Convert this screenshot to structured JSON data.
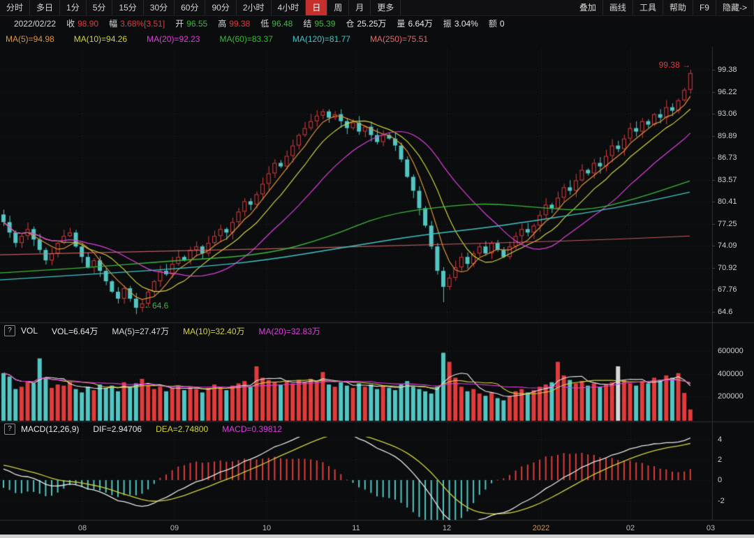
{
  "toolbar": {
    "left_tabs": [
      "分时",
      "多日",
      "1分",
      "5分",
      "15分",
      "30分",
      "60分",
      "90分",
      "2小时",
      "4小时",
      "日",
      "周",
      "月",
      "更多"
    ],
    "active_index": 10,
    "right_tabs": [
      "叠加",
      "画线",
      "工具",
      "帮助",
      "F9",
      "隐藏->"
    ]
  },
  "info_bar": {
    "date": "2022/02/22",
    "fields": [
      {
        "label": "收",
        "value": "98.90",
        "color": "#e23b3b"
      },
      {
        "label": "幅",
        "value": "3.68%[3.51]",
        "color": "#e23b3b"
      },
      {
        "label": "开",
        "value": "96.55",
        "color": "#3db93d"
      },
      {
        "label": "高",
        "value": "99.38",
        "color": "#e23b3b"
      },
      {
        "label": "低",
        "value": "96.48",
        "color": "#3db93d"
      },
      {
        "label": "结",
        "value": "95.39",
        "color": "#3db93d"
      },
      {
        "label": "仓",
        "value": "25.25万",
        "color": "#e8e8e8"
      },
      {
        "label": "量",
        "value": "6.64万",
        "color": "#e8e8e8"
      },
      {
        "label": "振",
        "value": "3.04%",
        "color": "#e8e8e8"
      },
      {
        "label": "额",
        "value": "0",
        "color": "#e8e8e8"
      }
    ]
  },
  "price_ma_legend": [
    {
      "text": "MA(5)=94.98",
      "color": "#e0953c"
    },
    {
      "text": "MA(10)=94.26",
      "color": "#d3d33f"
    },
    {
      "text": "MA(20)=92.23",
      "color": "#df3fdf"
    },
    {
      "text": "MA(60)=83.37",
      "color": "#3bb93b"
    },
    {
      "text": "MA(120)=81.77",
      "color": "#3fc6c6"
    },
    {
      "text": "MA(250)=75.51",
      "color": "#e06c6c"
    }
  ],
  "vol_header": {
    "help_icon": "?",
    "title": "VOL",
    "fields": [
      {
        "text": "VOL=6.64万",
        "color": "#e8e8e8"
      },
      {
        "text": "MA(5)=27.47万",
        "color": "#d9d9d9"
      },
      {
        "text": "MA(10)=32.40万",
        "color": "#d3d33f"
      },
      {
        "text": "MA(20)=32.83万",
        "color": "#df3fdf"
      }
    ]
  },
  "macd_header": {
    "help_icon": "?",
    "title": "MACD(12,26,9)",
    "fields": [
      {
        "text": "DIF=2.94706",
        "color": "#e8e8e8"
      },
      {
        "text": "DEA=2.74800",
        "color": "#d3d33f"
      },
      {
        "text": "MACD=0.39812",
        "color": "#df3fdf"
      }
    ]
  },
  "chart_data": {
    "type": "candlestick+volume+macd",
    "price_axis_labels": [
      "99.38",
      "96.22",
      "93.06",
      "89.89",
      "86.73",
      "83.57",
      "80.41",
      "77.25",
      "74.09",
      "70.92",
      "67.76",
      "64.6"
    ],
    "volume_axis_labels": [
      "600000",
      "400000",
      "200000"
    ],
    "macd_axis_labels": [
      "4",
      "2",
      "0",
      "-2"
    ],
    "x_axis": {
      "labels": [
        "08",
        "09",
        "10",
        "11",
        "12",
        "2022",
        "02",
        "03"
      ],
      "positions": [
        118,
        250,
        382,
        510,
        640,
        775,
        903,
        1018
      ],
      "highlight_label": "2022",
      "highlight_color": "#e0953c"
    },
    "ylim": [
      64.6,
      99.38
    ],
    "closes": [
      77.5,
      76.0,
      74.5,
      75.5,
      76.5,
      75.0,
      73.5,
      72.0,
      73.0,
      74.5,
      75.5,
      76.0,
      74.0,
      72.5,
      71.0,
      72.0,
      70.5,
      69.0,
      67.5,
      66.5,
      68.0,
      66.5,
      65.2,
      65.8,
      67.5,
      69.0,
      70.5,
      70.0,
      71.5,
      72.5,
      72.0,
      73.5,
      74.0,
      73.0,
      74.5,
      75.5,
      76.5,
      76.0,
      77.5,
      79.0,
      80.5,
      80.0,
      81.5,
      83.0,
      84.5,
      86.0,
      85.5,
      87.0,
      88.5,
      90.0,
      91.0,
      92.0,
      92.8,
      93.4,
      92.5,
      93.0,
      92.0,
      91.0,
      91.8,
      90.5,
      91.2,
      90.0,
      89.0,
      90.0,
      89.5,
      88.5,
      86.5,
      84.0,
      82.0,
      79.5,
      77.0,
      74.0,
      70.5,
      68.2,
      69.5,
      71.0,
      72.5,
      71.5,
      73.0,
      74.0,
      73.0,
      74.5,
      73.5,
      72.5,
      74.0,
      75.5,
      76.5,
      76.0,
      77.0,
      78.5,
      80.0,
      79.5,
      81.0,
      82.5,
      82.0,
      83.5,
      85.0,
      84.5,
      86.0,
      85.5,
      87.0,
      88.5,
      88.0,
      89.5,
      91.0,
      90.5,
      92.0,
      91.5,
      93.0,
      92.5,
      94.0,
      93.5,
      95.0,
      96.5,
      98.9
    ],
    "volumes": [
      420000,
      390000,
      280000,
      300000,
      350000,
      330000,
      550000,
      380000,
      290000,
      320000,
      310000,
      340000,
      280000,
      250000,
      300000,
      270000,
      320000,
      290000,
      310000,
      260000,
      340000,
      300000,
      330000,
      370000,
      310000,
      280000,
      300000,
      260000,
      290000,
      310000,
      270000,
      300000,
      280000,
      250000,
      290000,
      320000,
      300000,
      270000,
      310000,
      330000,
      350000,
      300000,
      480000,
      380000,
      360000,
      340000,
      320000,
      350000,
      330000,
      360000,
      340000,
      370000,
      350000,
      430000,
      320000,
      300000,
      340000,
      310000,
      290000,
      330000,
      300000,
      320000,
      280000,
      310000,
      290000,
      270000,
      320000,
      350000,
      300000,
      280000,
      260000,
      240000,
      300000,
      600000,
      520000,
      380000,
      300000,
      260000,
      280000,
      240000,
      220000,
      250000,
      200000,
      180000,
      220000,
      260000,
      280000,
      250000,
      270000,
      300000,
      320000,
      340000,
      520000,
      400000,
      360000,
      330000,
      350000,
      310000,
      330000,
      300000,
      320000,
      340000,
      480000,
      360000,
      330000,
      310000,
      350000,
      330000,
      380000,
      360000,
      400000,
      380000,
      420000,
      245000,
      100000
    ],
    "highlight_volume_index": 102,
    "ma60_path": [
      [
        0,
        70.2
      ],
      [
        120,
        70.9
      ],
      [
        240,
        71.9
      ],
      [
        380,
        72.8
      ],
      [
        470,
        75.3
      ],
      [
        550,
        78.6
      ],
      [
        640,
        79.8
      ],
      [
        700,
        80.2
      ],
      [
        770,
        79.6
      ],
      [
        840,
        79.1
      ],
      [
        910,
        80.8
      ],
      [
        988,
        83.4
      ]
    ],
    "ma120_path": [
      [
        0,
        69.2
      ],
      [
        150,
        70.1
      ],
      [
        280,
        71.0
      ],
      [
        380,
        72.0
      ],
      [
        500,
        74.0
      ],
      [
        600,
        75.6
      ],
      [
        680,
        76.5
      ],
      [
        740,
        77.3
      ],
      [
        850,
        79.0
      ],
      [
        920,
        80.3
      ],
      [
        988,
        81.8
      ]
    ],
    "ma250_path": [
      [
        0,
        72.8
      ],
      [
        300,
        73.4
      ],
      [
        600,
        74.2
      ],
      [
        850,
        74.9
      ],
      [
        988,
        75.5
      ]
    ],
    "annotations": {
      "high": {
        "text": "99.38 →",
        "price": 99.38
      },
      "low": {
        "text": "←64.6",
        "price": 64.6
      }
    },
    "colors": {
      "up": "#e03c3c",
      "down": "#53c6c3",
      "ma5": "#e0953c",
      "ma10": "#d3d33f",
      "ma20": "#df3fdf",
      "ma60": "#3bb93b",
      "ma120": "#3fc6c6",
      "ma250": "#e06c6c",
      "vol_ma5": "#e8e8e8",
      "vol_ma10": "#d3d33f",
      "vol_ma20": "#df3fdf",
      "dif": "#e8e8e8",
      "dea": "#d3d33f",
      "hist_up": "#e03c3c",
      "hist_down": "#53c6c3",
      "highlight_bar": "#d8d8d8",
      "grid": "#26272c",
      "axis_line": "#303138"
    }
  }
}
